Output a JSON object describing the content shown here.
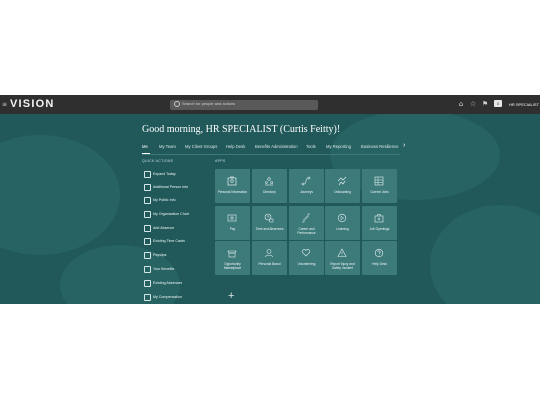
{
  "header": {
    "logo_mark": "≡",
    "logo": "VISION",
    "search_placeholder": "Search for people and actions",
    "icons": [
      "home-icon",
      "favorites-icon",
      "flag-icon"
    ],
    "notifications_count": "0",
    "user": "HR SPECIALIST"
  },
  "greeting": "Good morning, HR SPECIALIST (Curtis Feitty)!",
  "tabs": [
    {
      "label": "Me",
      "active": true
    },
    {
      "label": "My Team",
      "active": false
    },
    {
      "label": "My Client Groups",
      "active": false
    },
    {
      "label": "Help Desk",
      "active": false
    },
    {
      "label": "Benefits Administration",
      "active": false
    },
    {
      "label": "Tools",
      "active": false
    },
    {
      "label": "My Reporting",
      "active": false
    },
    {
      "label": "Business Resilience",
      "active": false
    }
  ],
  "quick_actions": {
    "heading": "QUICK ACTIONS",
    "items": [
      {
        "label": "Expand Today",
        "icon": "calendar-icon"
      },
      {
        "label": "Additional Person Info",
        "icon": "person-info-icon"
      },
      {
        "label": "My Public Info",
        "icon": "id-card-icon"
      },
      {
        "label": "My Organization Chart",
        "icon": "org-chart-icon"
      },
      {
        "label": "Add Absence",
        "icon": "calendar-add-icon"
      },
      {
        "label": "Existing Time Cards",
        "icon": "timecard-icon"
      },
      {
        "label": "Payslips",
        "icon": "payslip-icon"
      },
      {
        "label": "Your Benefits",
        "icon": "benefits-icon"
      },
      {
        "label": "Existing Absences",
        "icon": "calendar-list-icon"
      },
      {
        "label": "My Compensation",
        "icon": "compensation-icon"
      }
    ]
  },
  "apps": {
    "heading": "APPS",
    "tiles": [
      {
        "label": "Personal Information",
        "icon": "person-card-icon"
      },
      {
        "label": "Directory",
        "icon": "directory-icon"
      },
      {
        "label": "Journeys",
        "icon": "journeys-icon"
      },
      {
        "label": "Onboarding",
        "icon": "onboarding-icon"
      },
      {
        "label": "Current Jobs",
        "icon": "current-jobs-icon"
      },
      {
        "label": "Pay",
        "icon": "pay-icon"
      },
      {
        "label": "Time and Absences",
        "icon": "time-absences-icon"
      },
      {
        "label": "Career and Performance",
        "icon": "career-icon"
      },
      {
        "label": "Learning",
        "icon": "learning-icon"
      },
      {
        "label": "Job Openings",
        "icon": "job-openings-icon"
      },
      {
        "label": "Opportunity Marketplace",
        "icon": "marketplace-icon"
      },
      {
        "label": "Personal Brand",
        "icon": "personal-brand-icon"
      },
      {
        "label": "Volunteering",
        "icon": "volunteering-icon"
      },
      {
        "label": "Report Injury and Safety Incident",
        "icon": "safety-icon"
      },
      {
        "label": "Help Desk",
        "icon": "help-desk-icon"
      }
    ]
  },
  "colors": {
    "background": "#21595a",
    "tile": "#3d7b7b",
    "topbar": "#2f2f2f"
  }
}
